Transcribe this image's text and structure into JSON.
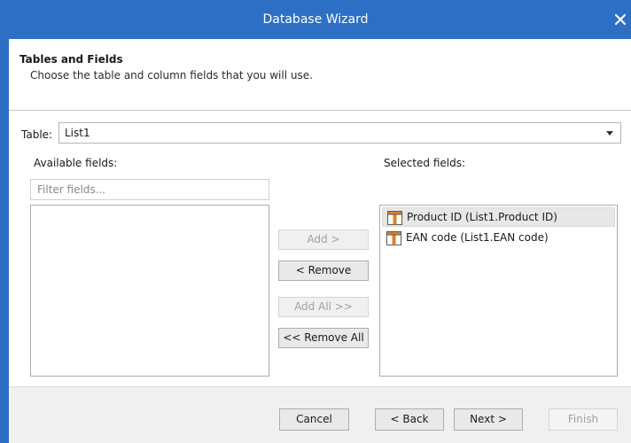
{
  "window": {
    "title": "Database Wizard",
    "close_icon": "close-icon"
  },
  "header": {
    "title": "Tables and Fields",
    "description": "Choose the table and column fields that you will use."
  },
  "table_select": {
    "label": "Table:",
    "value": "List1"
  },
  "available": {
    "label": "Available fields:",
    "filter_placeholder": "Filter fields...",
    "filter_value": "",
    "items": []
  },
  "selected": {
    "label": "Selected fields:",
    "items": [
      {
        "label": "Product ID (List1.Product ID)",
        "icon": "table-field-icon",
        "selected": true
      },
      {
        "label": "EAN code (List1.EAN code)",
        "icon": "table-field-icon",
        "selected": false
      }
    ]
  },
  "transfer_buttons": {
    "add": "Add >",
    "remove": "< Remove",
    "add_all": "Add All >>",
    "remove_all": "<< Remove All"
  },
  "footer": {
    "cancel": "Cancel",
    "back": "< Back",
    "next": "Next >",
    "finish": "Finish"
  },
  "colors": {
    "titlebar": "#2d6fc4",
    "footer_bg": "#f0f0f0",
    "selected_row": "#e7e7e7",
    "icon_orange": "#d9822b"
  }
}
